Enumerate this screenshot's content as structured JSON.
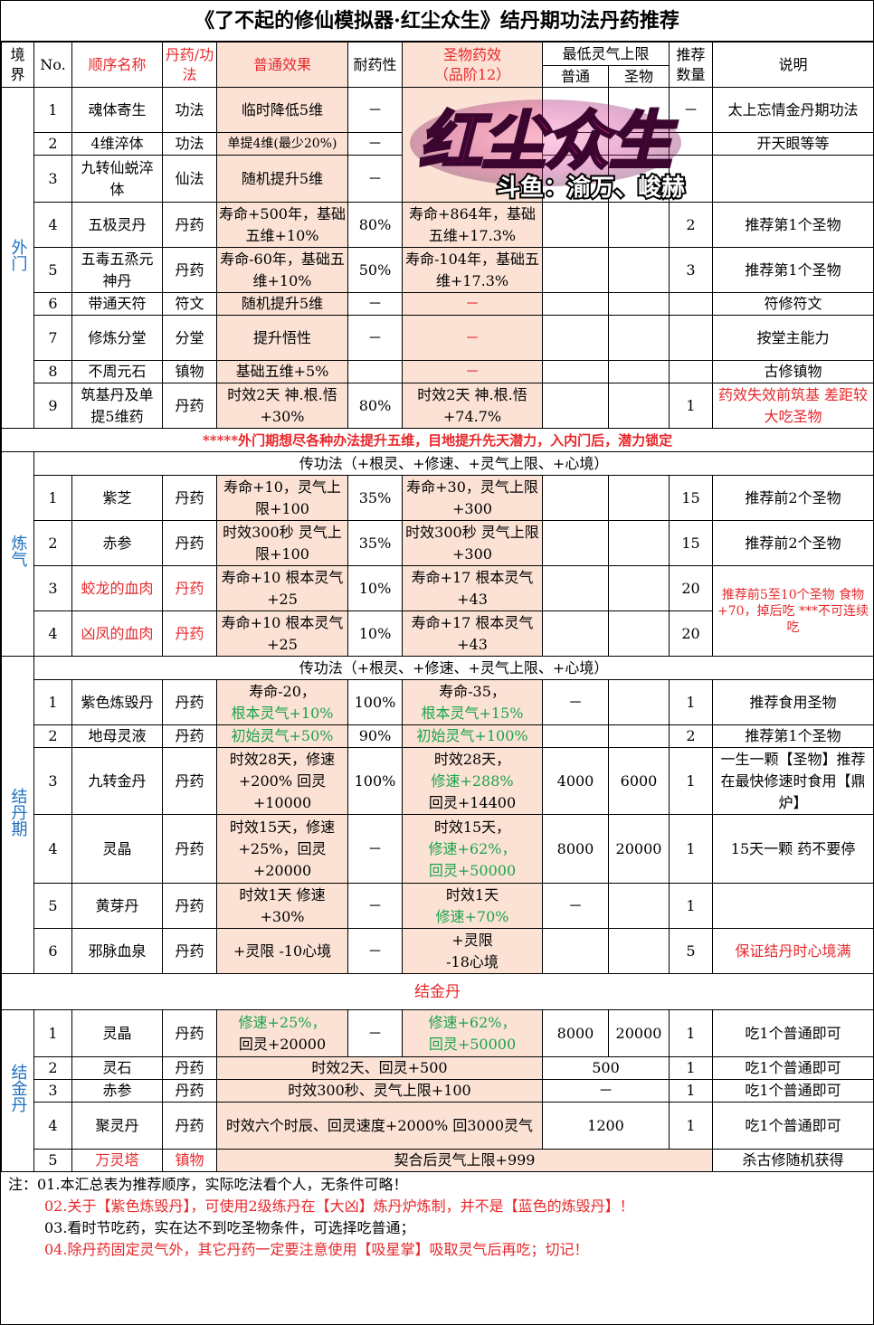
{
  "title": "《了不起的修仙模拟器·红尘众生》结丹期功法丹药推荐",
  "watermark": {
    "logo_text": "红尘众生",
    "caption": "斗鱼：渝万、峻赫"
  },
  "headers": {
    "realm": "境界",
    "no": "No.",
    "name": "顺序名称",
    "type": "丹药/功法",
    "effect": "普通效果",
    "tolerance": "耐药性",
    "holy": "圣物药效",
    "holy_sub": "（品阶12）",
    "min_limit": "最低灵气上限",
    "normal": "普通",
    "holyc": "圣物",
    "count": "推荐数量",
    "note": "说明"
  },
  "outer": {
    "realm": "外门",
    "rows": [
      {
        "no": "1",
        "name": "魂体寄生",
        "type": "功法",
        "eff": "临时降低5维",
        "tol": "－",
        "holy": "",
        "mn": "",
        "mh": "",
        "cnt": "－",
        "note": "太上忘情金丹期功法"
      },
      {
        "no": "2",
        "name": "4维淬体",
        "type": "功法",
        "eff": "单提4维(最少20%)",
        "tol": "－",
        "holy": "",
        "mn": "",
        "mh": "",
        "cnt": "",
        "note": "开天眼等等"
      },
      {
        "no": "3",
        "name": "九转仙蜕淬体",
        "type": "仙法",
        "eff": "随机提升5维",
        "tol": "－",
        "holy": "",
        "mn": "",
        "mh": "",
        "cnt": "",
        "note": ""
      },
      {
        "no": "4",
        "name": "五极灵丹",
        "type": "丹药",
        "eff": "寿命+500年，基础五维+10%",
        "tol": "80%",
        "holy": "寿命+864年，基础五维+17.3%",
        "mn": "",
        "mh": "",
        "cnt": "2",
        "note": "推荐第1个圣物"
      },
      {
        "no": "5",
        "name": "五毒五烝元神丹",
        "type": "丹药",
        "eff": "寿命-60年，基础五维+10%",
        "tol": "50%",
        "holy": "寿命-104年，基础五维+17.3%",
        "mn": "",
        "mh": "",
        "cnt": "3",
        "note": "推荐第1个圣物"
      },
      {
        "no": "6",
        "name": "带通天符",
        "type": "符文",
        "eff": "随机提升5维",
        "tol": "－",
        "holy": "－",
        "mn": "",
        "mh": "",
        "cnt": "",
        "note": "符修符文"
      },
      {
        "no": "7",
        "name": "修炼分堂",
        "type": "分堂",
        "eff": "提升悟性",
        "tol": "－",
        "holy": "－",
        "mn": "",
        "mh": "",
        "cnt": "",
        "note": "按堂主能力"
      },
      {
        "no": "8",
        "name": "不周元石",
        "type": "镇物",
        "eff": "基础五维+5%",
        "tol": "",
        "holy": "－",
        "mn": "",
        "mh": "",
        "cnt": "",
        "note": "古修镇物"
      },
      {
        "no": "9",
        "name": "筑基丹及单提5维药",
        "type": "丹药",
        "eff": "时效2天 神.根.悟+30%",
        "tol": "80%",
        "holy": "时效2天 神.根.悟+74.7%",
        "mn": "",
        "mh": "",
        "cnt": "1",
        "note": "药效失效前筑基 差距较大吃圣物"
      }
    ],
    "banner": "*****外门期想尽各种办法提升五维，目地提升先天潜力，入内门后，潜力锁定"
  },
  "qi": {
    "realm": "炼气",
    "section": "传功法（+根灵、+修速、+灵气上限、+心境）",
    "rows": [
      {
        "no": "1",
        "name": "紫芝",
        "type": "丹药",
        "eff": "寿命+10，灵气上限+100",
        "tol": "35%",
        "holy": "寿命+30，灵气上限+300",
        "cnt": "15",
        "note": "推荐前2个圣物"
      },
      {
        "no": "2",
        "name": "赤参",
        "type": "丹药",
        "eff": "时效300秒 灵气上限+100",
        "tol": "35%",
        "holy": "时效300秒 灵气上限+300",
        "cnt": "15",
        "note": "推荐前2个圣物"
      },
      {
        "no": "3",
        "name": "蛟龙的血肉",
        "type": "丹药",
        "eff": "寿命+10 根本灵气+25",
        "tol": "10%",
        "holy": "寿命+17 根本灵气+43",
        "cnt": "20"
      },
      {
        "no": "4",
        "name": "凶凤的血肉",
        "type": "丹药",
        "eff": "寿命+10 根本灵气+25",
        "tol": "10%",
        "holy": "寿命+17 根本灵气+43",
        "cnt": "20"
      }
    ],
    "merged_note": "推荐前5至10个圣物 食物+70，掉后吃 ***不可连续吃"
  },
  "core": {
    "realm": "结丹期",
    "section": "传功法（+根灵、+修速、+灵气上限、+心境）",
    "rows": [
      {
        "no": "1",
        "name": "紫色炼毁丹",
        "type": "丹药",
        "eff1": "寿命-20，",
        "eff2": "根本灵气+10%",
        "tol": "100%",
        "h1": "寿命-35，",
        "h2": "根本灵气+15%",
        "mn": "－",
        "mh": "",
        "cnt": "1",
        "note": "推荐食用圣物"
      },
      {
        "no": "2",
        "name": "地母灵液",
        "type": "丹药",
        "eff2": "初始灵气+50%",
        "tol": "90%",
        "h2": "初始灵气+100%",
        "mn": "",
        "mh": "",
        "cnt": "2",
        "note": "推荐第1个圣物"
      },
      {
        "no": "3",
        "name": "九转金丹",
        "type": "丹药",
        "eff1": "时效28天，修速+200% 回灵+10000",
        "tol": "100%",
        "h1": "时效28天，",
        "h2": "修速+288%",
        "h3": "回灵+14400",
        "mn": "4000",
        "mh": "6000",
        "cnt": "1",
        "note": "一生一颗【圣物】推荐在最快修速时食用【鼎炉】"
      },
      {
        "no": "4",
        "name": "灵晶",
        "type": "丹药",
        "eff1": "时效15天，修速+25%，回灵+20000",
        "tol": "－",
        "h1": "时效15天，",
        "h2": "修速+62%，",
        "h3": "回灵+50000",
        "mn": "8000",
        "mh": "20000",
        "cnt": "1",
        "note": "15天一颗 药不要停"
      },
      {
        "no": "5",
        "name": "黄芽丹",
        "type": "丹药",
        "eff1": "时效1天 修速+30%",
        "tol": "－",
        "h1": "时效1天",
        "h2": "修速+70%",
        "mn": "－",
        "mh": "",
        "cnt": "1",
        "note": ""
      },
      {
        "no": "6",
        "name": "邪脉血泉",
        "type": "丹药",
        "eff1": "+灵限 -10心境",
        "tol": "－",
        "h1": "+灵限",
        "h3": "-18心境",
        "mn": "",
        "mh": "",
        "cnt": "5",
        "note": "保证结丹时心境满"
      }
    ]
  },
  "gold": {
    "realm": "结金丹",
    "section": "结金丹",
    "rows": [
      {
        "no": "1",
        "name": "灵晶",
        "type": "丹药",
        "e1": "修速+25%，",
        "e2": "回灵+20000",
        "tol": "－",
        "h1": "修速+62%，",
        "h2": "回灵+50000",
        "mn": "8000",
        "mh": "20000",
        "cnt": "1",
        "note": "吃1个普通即可"
      },
      {
        "no": "2",
        "name": "灵石",
        "type": "丹药",
        "merged": "时效2天、回灵+500",
        "lim": "500",
        "cnt": "1",
        "note": "吃1个普通即可"
      },
      {
        "no": "3",
        "name": "赤参",
        "type": "丹药",
        "merged": "时效300秒、灵气上限+100",
        "lim": "－",
        "cnt": "1",
        "note": "吃1个普通即可"
      },
      {
        "no": "4",
        "name": "聚灵丹",
        "type": "丹药",
        "merged": "时效六个时辰、回灵速度+2000% 回3000灵气",
        "lim": "1200",
        "cnt": "1",
        "note": "吃1个普通即可"
      },
      {
        "no": "5",
        "name": "万灵塔",
        "type": "镇物",
        "merged": "契合后灵气上限+999",
        "note": "杀古修随机获得"
      }
    ]
  },
  "notes": [
    "注：01.本汇总表为推荐顺序，实际吃法看个人，无条件可略！",
    "02.关于【紫色炼毁丹】，可使用2级练丹在【大凶】炼丹炉炼制，并不是【蓝色的炼毁丹】！",
    "03.看时节吃药，实在达不到吃圣物条件，可选择吃普通；",
    "04.除丹药固定灵气外，其它丹药一定要注意使用【吸星掌】吸取灵气后再吃；切记！"
  ]
}
